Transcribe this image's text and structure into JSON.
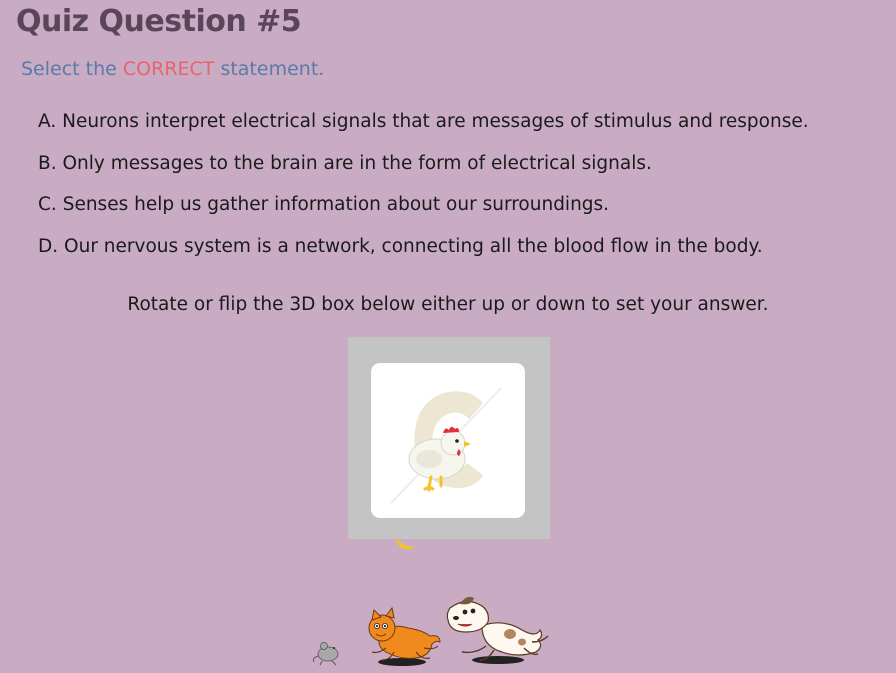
{
  "quiz": {
    "title": "Quiz Question #5",
    "instruction_prefix": "Select the",
    "instruction_emphasis": "CORRECT",
    "instruction_suffix": "statement.",
    "options": [
      {
        "letter": "A.",
        "text": "Neurons interpret electrical signals that are messages of stimulus and response."
      },
      {
        "letter": "B.",
        "text": "Only messages to the brain are in the form of electrical signals."
      },
      {
        "letter": "C.",
        "text": "Senses help us gather information about our surroundings."
      },
      {
        "letter": "D.",
        "text": "Our nervous system is a network, connecting all the blood flow in the body."
      }
    ],
    "rotate_hint": "Rotate or flip the 3D box below either up or down to set your answer."
  },
  "answer_box": {
    "face_letter_icon": "letter-c-icon",
    "face_animal_icon": "chicken-icon"
  },
  "decorations": {
    "icons": [
      "crescent-moon-icon",
      "mouse-icon",
      "cat-icon",
      "dog-icon"
    ]
  },
  "colors": {
    "background": "#c9abc4",
    "title": "#5b4558",
    "instruction": "#5a7aa8",
    "emphasis": "#e8646c",
    "box_frame": "#c4c4c4"
  }
}
